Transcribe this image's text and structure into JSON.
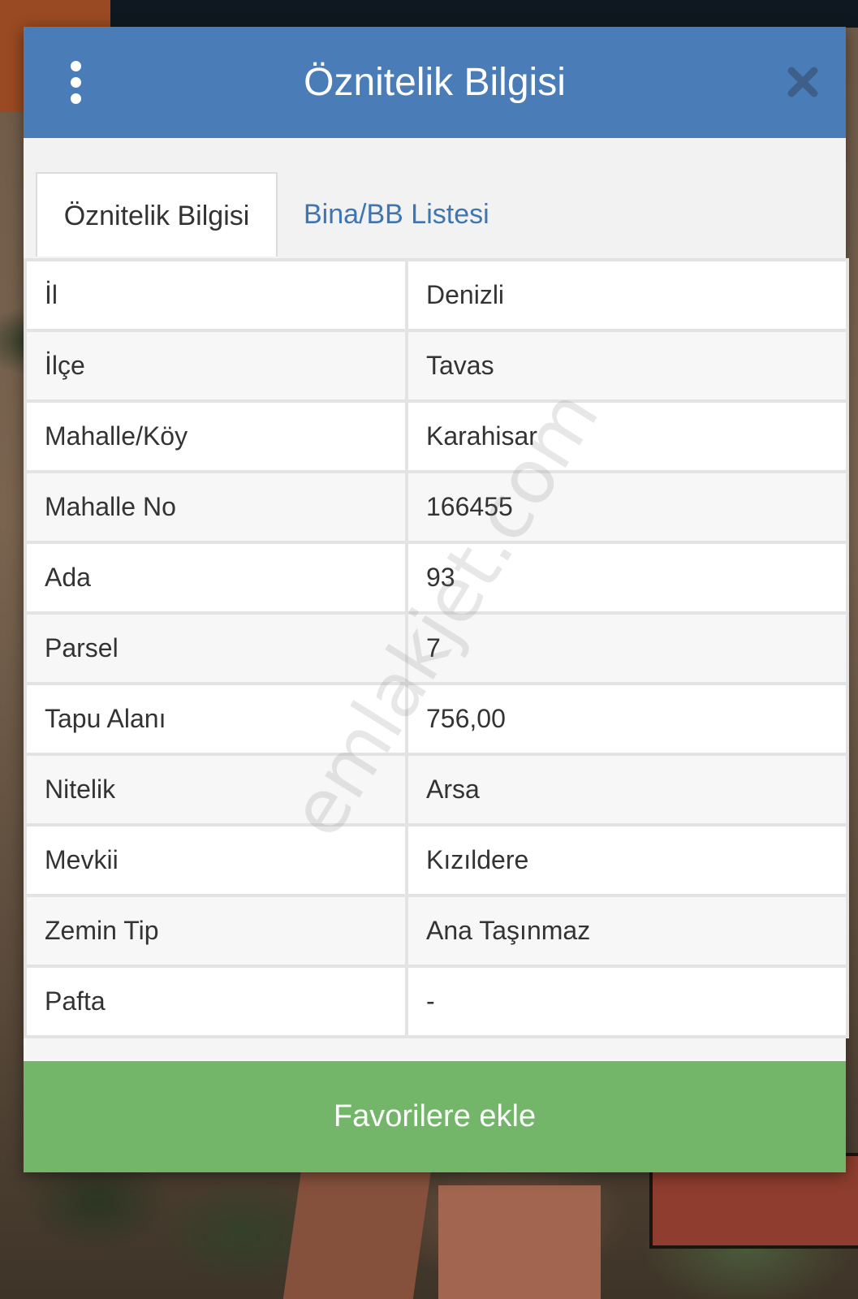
{
  "dialog": {
    "title": "Öznitelik Bilgisi",
    "menu_icon": "more-vertical-icon",
    "close_icon": "close-icon"
  },
  "tabs": [
    {
      "label": "Öznitelik Bilgisi",
      "active": true
    },
    {
      "label": "Bina/BB Listesi",
      "active": false
    }
  ],
  "attributes": [
    {
      "key": "İl",
      "value": "Denizli"
    },
    {
      "key": "İlçe",
      "value": "Tavas"
    },
    {
      "key": "Mahalle/Köy",
      "value": "Karahisar"
    },
    {
      "key": "Mahalle No",
      "value": "166455"
    },
    {
      "key": "Ada",
      "value": "93"
    },
    {
      "key": "Parsel",
      "value": "7"
    },
    {
      "key": "Tapu Alanı",
      "value": "756,00"
    },
    {
      "key": "Nitelik",
      "value": "Arsa"
    },
    {
      "key": "Mevkii",
      "value": "Kızıldere"
    },
    {
      "key": "Zemin Tip",
      "value": "Ana Taşınmaz"
    },
    {
      "key": "Pafta",
      "value": "-"
    }
  ],
  "footer": {
    "favorite_label": "Favorilere ekle"
  },
  "watermark": "emlakjet.com",
  "colors": {
    "header": "#4a7db8",
    "tab_link": "#3f75b0",
    "favorite_button": "#73b66a"
  }
}
